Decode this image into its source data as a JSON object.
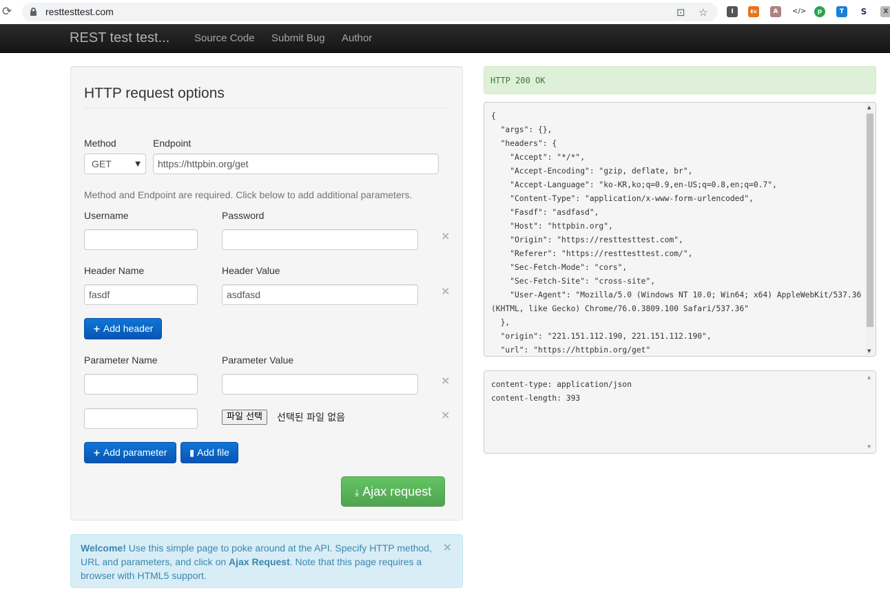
{
  "browser": {
    "url": "resttesttest.com",
    "reload_icon": "reload-icon",
    "extensions": [
      "I",
      "Ex",
      "A",
      "</>",
      "p",
      "T",
      "S",
      "X"
    ]
  },
  "navbar": {
    "brand": "REST test test...",
    "links": [
      "Source Code",
      "Submit Bug",
      "Author"
    ]
  },
  "form": {
    "legend": "HTTP request options",
    "method_label": "Method",
    "endpoint_label": "Endpoint",
    "method_value": "GET",
    "endpoint_value": "https://httpbin.org/get",
    "help_text": "Method and Endpoint are required. Click below to add additional parameters.",
    "username_label": "Username",
    "password_label": "Password",
    "username_value": "",
    "password_value": "",
    "header_name_label": "Header Name",
    "header_value_label": "Header Value",
    "header_name_value": "fasdf",
    "header_value_value": "asdfasd",
    "add_header_label": "Add header",
    "param_name_label": "Parameter Name",
    "param_value_label": "Parameter Value",
    "param_name_value": "",
    "param_value_value": "",
    "file_param_name_value": "",
    "file_button_label": "파일 선택",
    "file_status": "선택된 파일 없음",
    "add_parameter_label": "Add parameter",
    "add_file_label": "Add file",
    "ajax_button_label": "Ajax request",
    "remove_glyph": "×"
  },
  "alert_info": {
    "strong": "Welcome!",
    "text1": " Use this simple page to poke around at the API. Specify HTTP method, URL and parameters, and click on ",
    "strong2": "Ajax Request",
    "text2": ". Note that this page requires a browser with HTML5 support.",
    "close": "×"
  },
  "response": {
    "status": "HTTP 200 OK",
    "body_lines": [
      "{",
      "  \"args\": {},",
      "  \"headers\": {",
      "    \"Accept\": \"*/*\",",
      "    \"Accept-Encoding\": \"gzip, deflate, br\",",
      "    \"Accept-Language\": \"ko-KR,ko;q=0.9,en-US;q=0.8,en;q=0.7\",",
      "    \"Content-Type\": \"application/x-www-form-urlencoded\",",
      "    \"Fasdf\": \"asdfasd\",",
      "    \"Host\": \"httpbin.org\",",
      "    \"Origin\": \"https://resttesttest.com\",",
      "    \"Referer\": \"https://resttesttest.com/\",",
      "    \"Sec-Fetch-Mode\": \"cors\",",
      "    \"Sec-Fetch-Site\": \"cross-site\",",
      "    \"User-Agent\": \"Mozilla/5.0 (Windows NT 10.0; Win64; x64) AppleWebKit/537.36",
      "(KHTML, like Gecko) Chrome/76.0.3809.100 Safari/537.36\"",
      "  },",
      "  \"origin\": \"221.151.112.190, 221.151.112.190\",",
      "  \"url\": \"https://httpbin.org/get\""
    ],
    "headers_lines": [
      "content-type: application/json",
      "content-length: 393"
    ]
  }
}
